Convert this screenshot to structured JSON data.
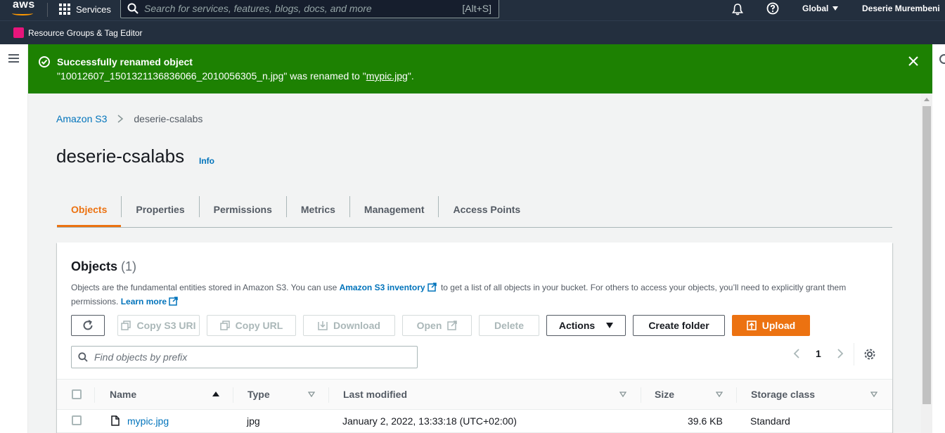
{
  "topnav": {
    "logo": "aws",
    "services": "Services",
    "search_placeholder": "Search for services, features, blogs, docs, and more",
    "search_shortcut": "[Alt+S]",
    "region": "Global",
    "user": "Deserie Murembeni"
  },
  "subnav": {
    "resource_groups": "Resource Groups & Tag Editor"
  },
  "flash": {
    "title": "Successfully renamed object",
    "message_prefix": "\"10012607_1501321136836066_2010056305_n.jpg\" was renamed to \"",
    "message_link": "mypic.jpg",
    "message_suffix": "\"."
  },
  "breadcrumb": {
    "root": "Amazon S3",
    "current": "deserie-csalabs"
  },
  "page": {
    "title": "deserie-csalabs",
    "info": "Info"
  },
  "tabs": [
    "Objects",
    "Properties",
    "Permissions",
    "Metrics",
    "Management",
    "Access Points"
  ],
  "objects_panel": {
    "title": "Objects",
    "count": "(1)",
    "desc_1": "Objects are the fundamental entities stored in Amazon S3. You can use ",
    "desc_link_1": "Amazon S3 inventory",
    "desc_2": " to get a list of all objects in your bucket. For others to access your objects, you’ll need to explicitly grant them permissions. ",
    "desc_link_2": "Learn more",
    "buttons": {
      "copy_s3_uri": "Copy S3 URI",
      "copy_url": "Copy URL",
      "download": "Download",
      "open": "Open",
      "delete": "Delete",
      "actions": "Actions",
      "create_folder": "Create folder",
      "upload": "Upload"
    },
    "filter_placeholder": "Find objects by prefix",
    "page": "1",
    "columns": {
      "name": "Name",
      "type": "Type",
      "last_modified": "Last modified",
      "size": "Size",
      "storage_class": "Storage class"
    },
    "rows": [
      {
        "name": "mypic.jpg",
        "type": "jpg",
        "last_modified": "January 2, 2022, 13:33:18 (UTC+02:00)",
        "size": "39.6 KB",
        "storage_class": "Standard"
      }
    ]
  },
  "colors": {
    "nav_bg": "#232f3e",
    "success": "#1d8102",
    "accent": "#ec7211",
    "link": "#0073bb"
  }
}
